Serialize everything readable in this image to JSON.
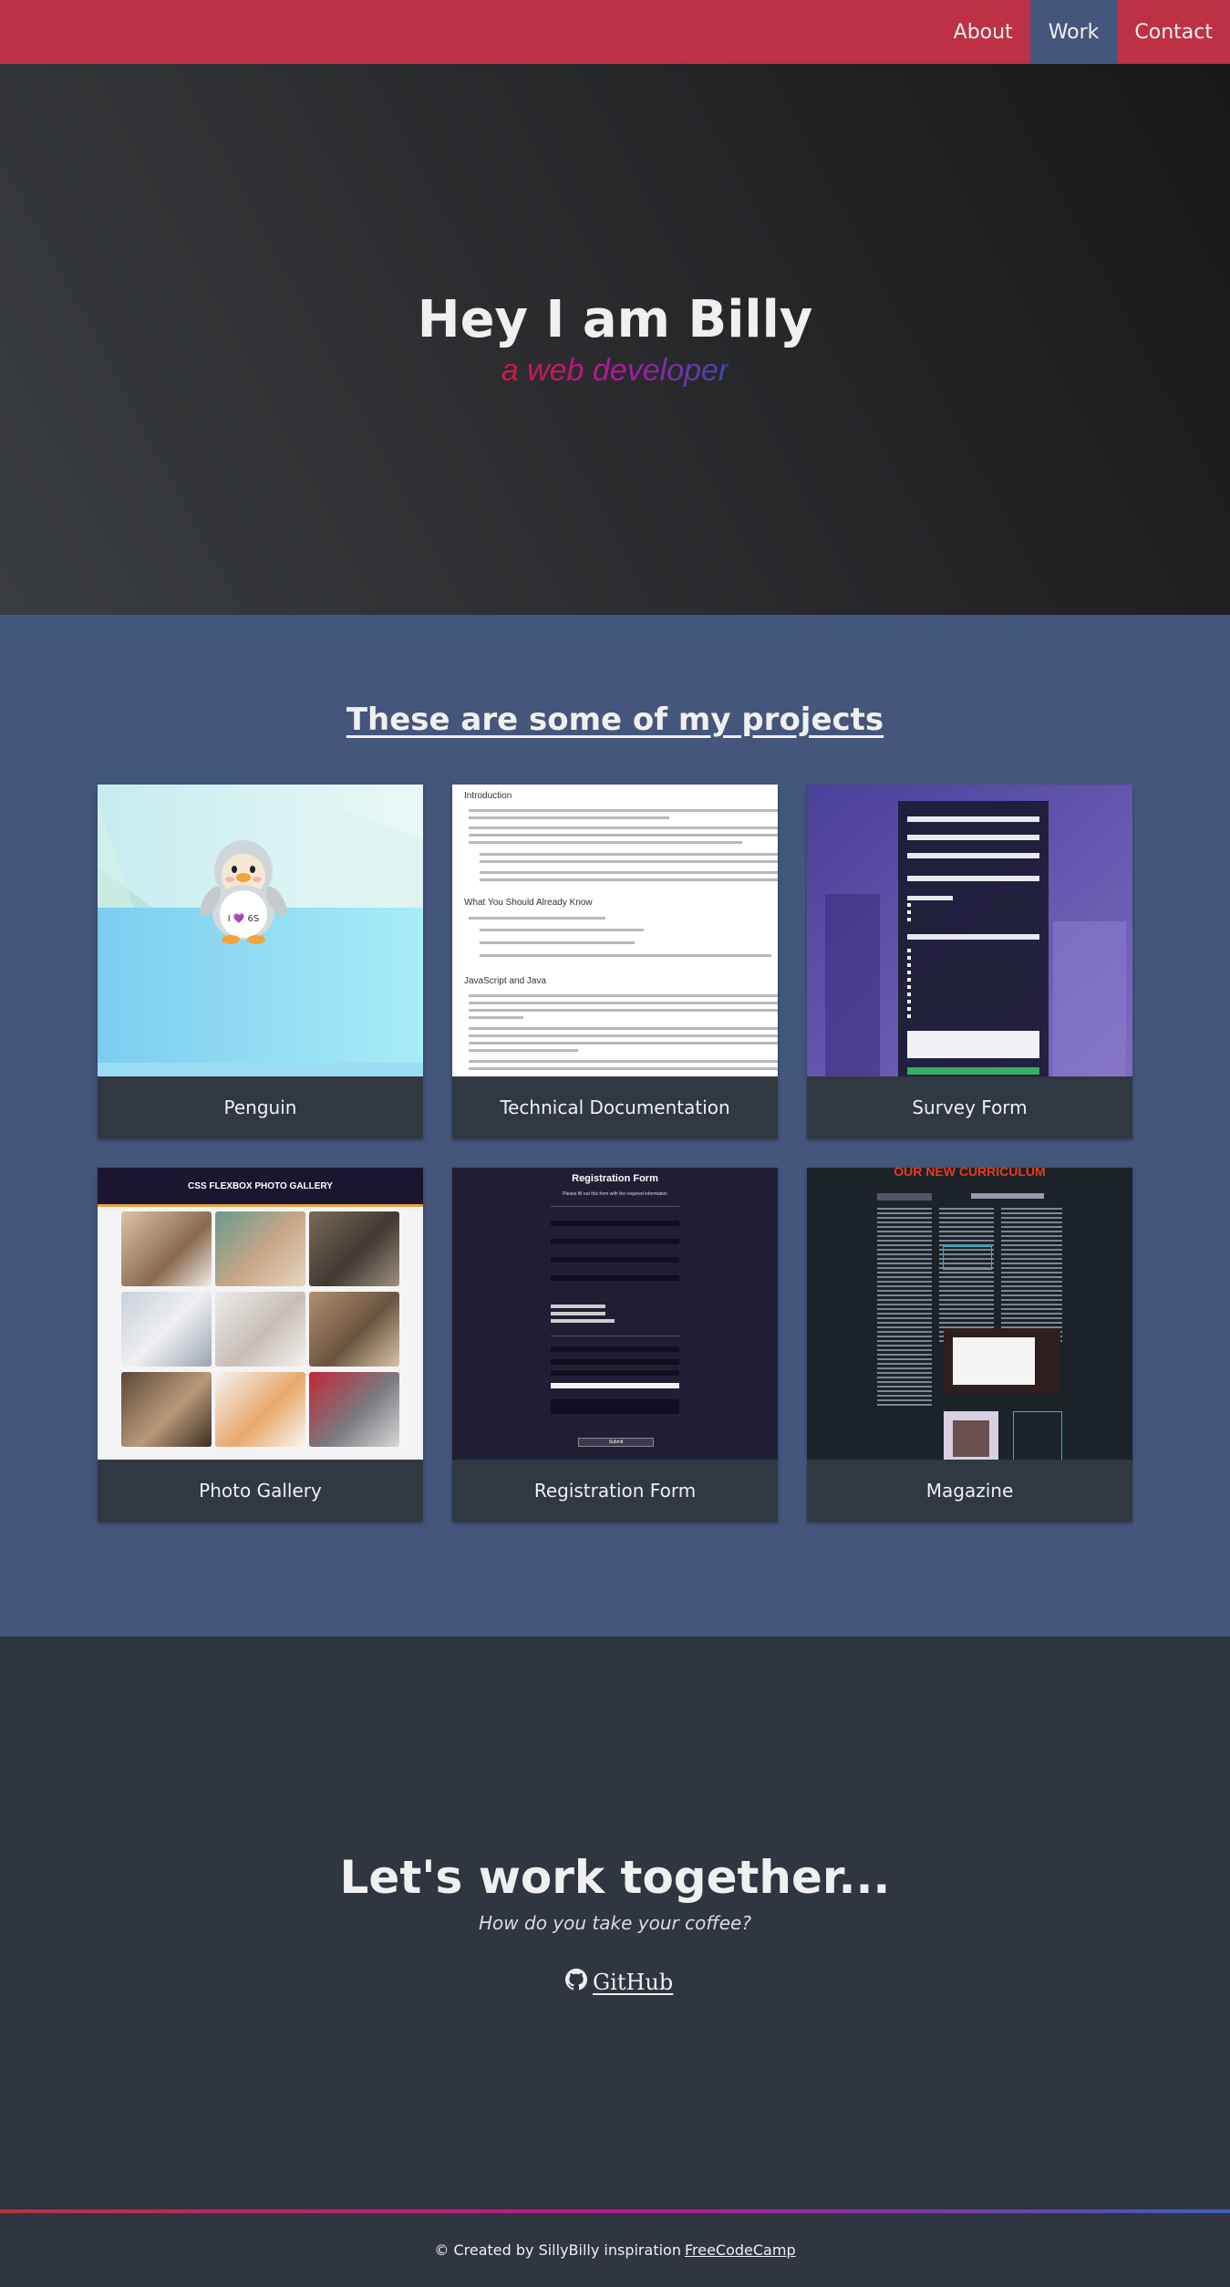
{
  "nav": {
    "items": [
      {
        "label": "About"
      },
      {
        "label": "Work"
      },
      {
        "label": "Contact"
      }
    ]
  },
  "hero": {
    "title": "Hey I am Billy",
    "subtitle": "a web developer"
  },
  "projects": {
    "heading": "These are some of my projects",
    "cards": [
      {
        "label": "Penguin"
      },
      {
        "label": "Technical Documentation"
      },
      {
        "label": "Survey Form"
      },
      {
        "label": "Photo Gallery"
      },
      {
        "label": "Registration Form"
      },
      {
        "label": "Magazine"
      }
    ],
    "thumbs": {
      "penguin_badge": "I 💜 6S",
      "doc_h1": "Introduction",
      "doc_h2": "What You Should Already Know",
      "doc_h3": "JavaScript and Java",
      "gallery_title": "CSS FLEXBOX PHOTO GALLERY",
      "reg_title": "Registration Form",
      "reg_sub": "Please fill out this form with the required information",
      "reg_submit": "Submit",
      "mag_title": "OUR NEW CURRICULUM"
    }
  },
  "contact": {
    "heading": "Let's work together...",
    "question": "How do you take your coffee?",
    "github_label": "GitHub"
  },
  "footer": {
    "text": "© Created by SillyBilly inspiration",
    "link": "FreeCodeCamp"
  },
  "colors": {
    "nav_bg": "#be3144",
    "nav_active": "#45567d",
    "projects_bg": "#45567d",
    "dark_bg": "#2f3640",
    "card_caption": "#303841"
  }
}
